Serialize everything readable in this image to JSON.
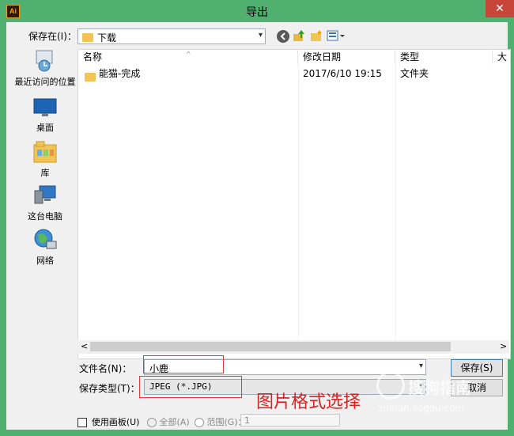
{
  "window": {
    "title": "导出",
    "app_icon": "Ai",
    "close_glyph": "✕"
  },
  "toolbar": {
    "save_in_label": "保存在(I)：",
    "location_value": "下载"
  },
  "sidebar": {
    "items": [
      {
        "label": "最近访问的位置",
        "icon": "recent-places-icon"
      },
      {
        "label": "桌面",
        "icon": "desktop-icon"
      },
      {
        "label": "库",
        "icon": "libraries-icon"
      },
      {
        "label": "这台电脑",
        "icon": "this-pc-icon"
      },
      {
        "label": "网络",
        "icon": "network-icon"
      }
    ]
  },
  "list": {
    "columns": [
      "名称",
      "修改日期",
      "类型",
      "大"
    ],
    "rows": [
      {
        "name": "能猫-完成",
        "modified": "2017/6/10 19:15",
        "type": "文件夹"
      }
    ]
  },
  "form": {
    "filename_label": "文件名(N)：",
    "filename_value": "小鹿",
    "filetype_label": "保存类型(T)：",
    "filetype_value": "JPEG (*.JPG)",
    "save_button": "保存(S)",
    "cancel_button": "取消"
  },
  "options": {
    "use_artboards": "使用画板(U)",
    "all": "全部(A)",
    "range": "范围(G)：",
    "range_value": "1"
  },
  "annotation": {
    "text": "图片格式选择",
    "color": "#e02020"
  },
  "watermark": {
    "brand": "搜狗指南",
    "url": "zhinan.sogou.com"
  },
  "colors": {
    "frame": "#4fb06f",
    "close": "#c7463a",
    "folder": "#f2c453"
  }
}
